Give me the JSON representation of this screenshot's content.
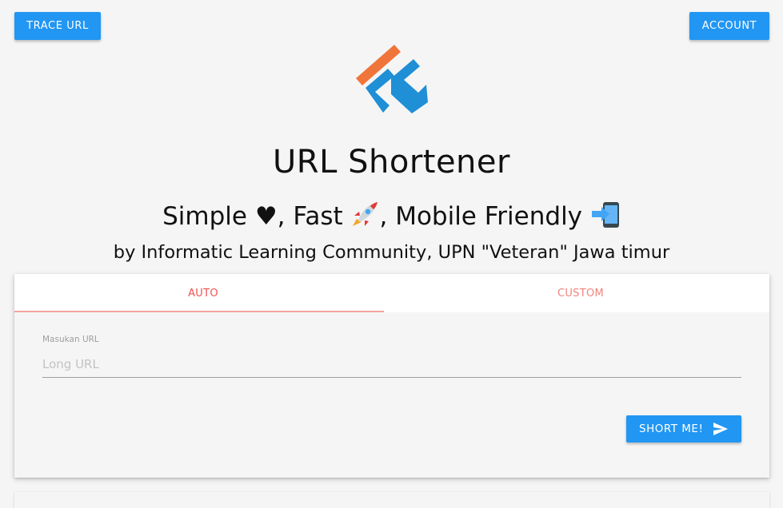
{
  "header": {
    "trace_label": "TRACE URL",
    "account_label": "ACCOUNT"
  },
  "hero": {
    "title": "URL Shortener",
    "sub_simple": "Simple ",
    "sub_heart": "♥",
    "sub_fast": ", Fast ",
    "sub_mobile": ", Mobile Friendly ",
    "byline": "by Informatic Learning Community, UPN \"Veteran\" Jawa timur"
  },
  "tabs": [
    {
      "label": "AUTO",
      "active": true
    },
    {
      "label": "CUSTOM",
      "active": false
    }
  ],
  "form": {
    "label": "Masukan URL",
    "placeholder": "Long URL",
    "value": "",
    "submit_label": "SHORT ME!"
  },
  "icons": {
    "logo": "ilc-logo",
    "heart": "heart-icon",
    "rocket": "rocket-icon",
    "phone": "mobile-phone-icon",
    "send": "send-icon"
  },
  "colors": {
    "primary": "#2196f3",
    "tab_accent": "#ef5350",
    "logo_orange": "#f0753a",
    "logo_blue": "#1f8fd6"
  }
}
